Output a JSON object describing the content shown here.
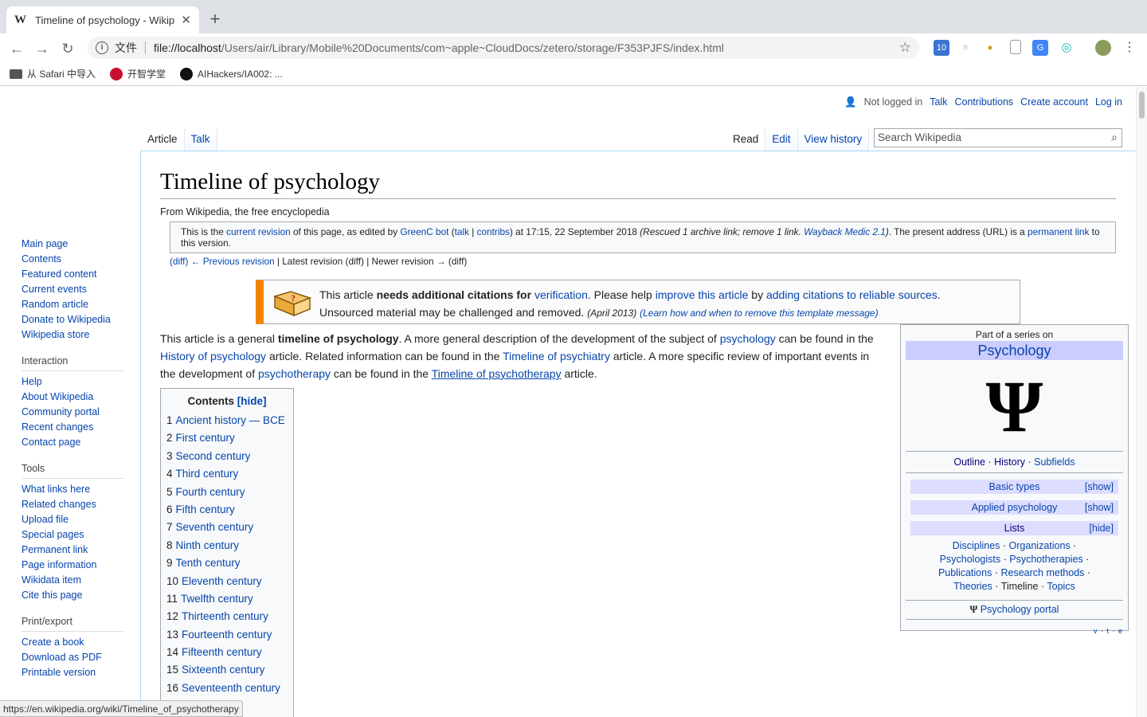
{
  "browser": {
    "tab_title": "Timeline of psychology - Wikip",
    "tab_favicon": "W",
    "url_scheme": "文件",
    "url_host": "file://localhost",
    "url_path": "/Users/air/Library/Mobile%20Documents/com~apple~CloudDocs/zetero/storage/F353PJFS/index.html",
    "bookmarks": [
      "从 Safari 中导入",
      "开智学堂",
      "AIHackers/IA002: ..."
    ],
    "ext_badge": "10"
  },
  "personal": {
    "not_logged_in": "Not logged in",
    "talk": "Talk",
    "contributions": "Contributions",
    "create_account": "Create account",
    "log_in": "Log in"
  },
  "nav": {
    "main": [
      "Main page",
      "Contents",
      "Featured content",
      "Current events",
      "Random article",
      "Donate to Wikipedia",
      "Wikipedia store"
    ],
    "interaction_header": "Interaction",
    "interaction": [
      "Help",
      "About Wikipedia",
      "Community portal",
      "Recent changes",
      "Contact page"
    ],
    "tools_header": "Tools",
    "tools": [
      "What links here",
      "Related changes",
      "Upload file",
      "Special pages",
      "Permanent link",
      "Page information",
      "Wikidata item",
      "Cite this page"
    ],
    "print_header": "Print/export",
    "print": [
      "Create a book",
      "Download as PDF",
      "Printable version"
    ]
  },
  "tabs": {
    "article": "Article",
    "talk": "Talk",
    "read": "Read",
    "edit": "Edit",
    "history": "View history",
    "search_placeholder": "Search Wikipedia"
  },
  "article": {
    "title": "Timeline of psychology",
    "sitesub": "From Wikipedia, the free encyclopedia",
    "rev": {
      "p1": "This is the ",
      "current_revision": "current revision",
      "p2": " of this page, as edited by ",
      "user": "GreenC bot",
      "p3": " (",
      "talk": "talk",
      "p4": " | ",
      "contribs": "contribs",
      "p5": ") at 17:15, 22 September 2018 ",
      "summary1": "(Rescued 1 archive link; remove 1 link. ",
      "wayback": "Wayback Medic 2.1",
      "summary2": ")",
      "p6": ". The present address (URL) is a ",
      "permanent_link": "permanent link",
      "p7": " to this version."
    },
    "revnav": {
      "diff1": "(diff)",
      "prev": "← Previous revision",
      "rest": " | Latest revision (diff) | Newer revision → (diff)"
    },
    "ambox": {
      "t1": "This article ",
      "bold": "needs additional citations for ",
      "verification": "verification",
      "t2": ". Please help ",
      "improve": "improve this article",
      "t3": " by ",
      "adding": "adding citations to reliable sources",
      "t4": ".",
      "line2": "Unsourced material may be challenged and removed.",
      "date": "(April 2013)",
      "learn": "(Learn how and when to remove this template message)"
    },
    "intro": {
      "a": "This article is a general ",
      "bold": "timeline of psychology",
      "b": ". A more general description of the development of the subject of ",
      "psychology": "psychology",
      "c": " can be found in the ",
      "history": "History of psychology",
      "d": " article. Related information can be found in the ",
      "psychiatry": "Timeline of psychiatry",
      "e": " article. A more specific review of important events in the development of ",
      "psychotherapy": "psychotherapy",
      "f": " can be found in the ",
      "tl_psychotherapy": "Timeline of psychotherapy",
      "g": " article."
    },
    "toc": {
      "title": "Contents",
      "toggle": "[hide]",
      "items": [
        {
          "n": "1",
          "t": "Ancient history — BCE"
        },
        {
          "n": "2",
          "t": "First century"
        },
        {
          "n": "3",
          "t": "Second century"
        },
        {
          "n": "4",
          "t": "Third century"
        },
        {
          "n": "5",
          "t": "Fourth century"
        },
        {
          "n": "6",
          "t": "Fifth century"
        },
        {
          "n": "7",
          "t": "Seventh century"
        },
        {
          "n": "8",
          "t": "Ninth century"
        },
        {
          "n": "9",
          "t": "Tenth century"
        },
        {
          "n": "10",
          "t": "Eleventh century"
        },
        {
          "n": "11",
          "t": "Twelfth century"
        },
        {
          "n": "12",
          "t": "Thirteenth century"
        },
        {
          "n": "13",
          "t": "Fourteenth century"
        },
        {
          "n": "14",
          "t": "Fifteenth century"
        },
        {
          "n": "15",
          "t": "Sixteenth century"
        },
        {
          "n": "16",
          "t": "Seventeenth century"
        }
      ]
    },
    "sidebox": {
      "pre": "Part of a series on",
      "title": "Psychology",
      "symbol": "Ψ",
      "outline": "Outline",
      "history": "History",
      "subfields": "Subfields",
      "dot": "·",
      "basic": "Basic types",
      "applied": "Applied psychology",
      "lists": "Lists",
      "show": "[show]",
      "hide": "[hide]",
      "disciplines": "Disciplines",
      "organizations": "Organizations",
      "psychologists": "Psychologists",
      "psychotherapies": "Psychotherapies",
      "publications": "Publications",
      "research": "Research methods",
      "theories": "Theories",
      "timeline": "Timeline",
      "topics": "Topics",
      "portal_symbol": "Ψ",
      "portal": "Psychology portal",
      "vte": "v · t · e"
    }
  },
  "statusbar": "https://en.wikipedia.org/wiki/Timeline_of_psychotherapy"
}
